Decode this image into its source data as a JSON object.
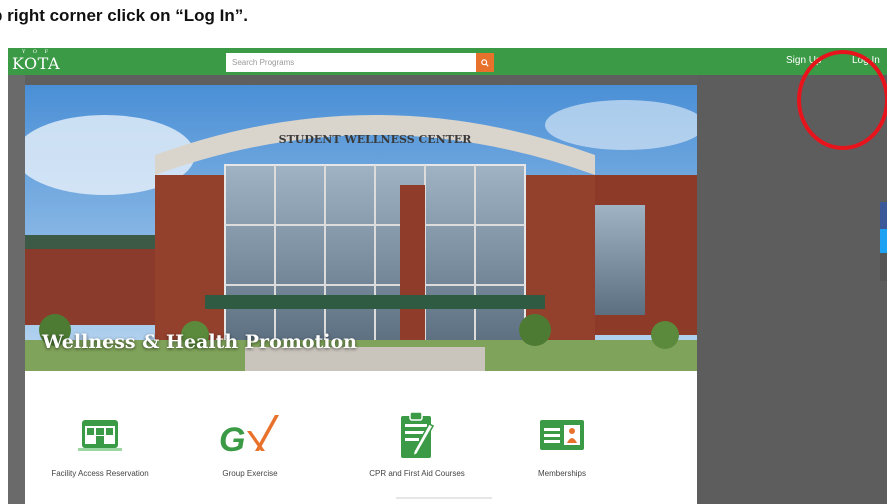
{
  "instruction": {
    "text": "p right corner click on “Log In”."
  },
  "brand": {
    "top_text": "Y O F",
    "name": "KOTA"
  },
  "search": {
    "placeholder": "Search Programs",
    "icon": "search-icon"
  },
  "nav": {
    "signup": "Sign Up",
    "login": "Log In"
  },
  "hero": {
    "title": "Wellness & Health Promotion",
    "building_sign": "STUDENT WELLNESS CENTER"
  },
  "programs": [
    {
      "label": "Facility Access Reservation",
      "icon": "facility-building-icon"
    },
    {
      "label": "Group Exercise",
      "icon": "gx-logo-icon"
    },
    {
      "label": "CPR and First Aid Courses",
      "icon": "clipboard-pen-icon"
    },
    {
      "label": "Memberships",
      "icon": "id-card-icon"
    }
  ],
  "colors": {
    "nav_green": "#3a9a45",
    "search_orange": "#e8722c",
    "annotation_red": "#e8141c",
    "icon_green": "#3a9a45"
  }
}
